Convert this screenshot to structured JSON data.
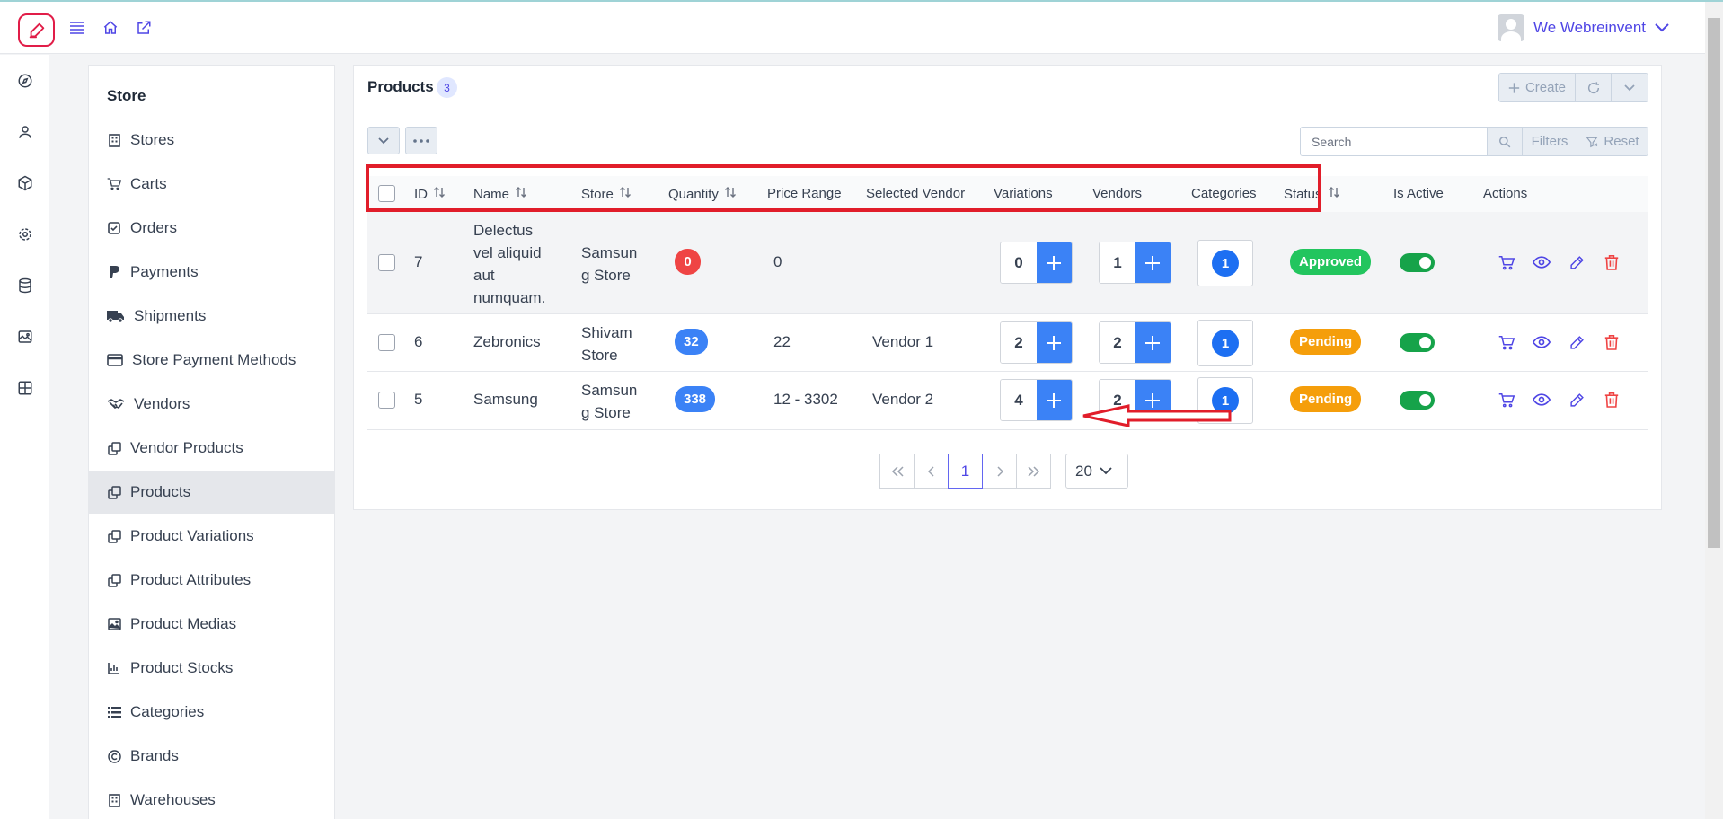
{
  "header": {
    "user_name": "We Webreinvent"
  },
  "icons": {
    "logo": "pencil-square-logo",
    "menu": "hamburger-icon",
    "home": "home-icon",
    "external": "external-link-icon"
  },
  "rail": [
    "compass-icon",
    "user-icon",
    "cube-icon",
    "gear-icon",
    "database-icon",
    "images-icon",
    "grid-icon"
  ],
  "store_menu": {
    "title": "Store",
    "items": [
      {
        "label": "Stores",
        "icon": "building-icon"
      },
      {
        "label": "Carts",
        "icon": "cart-icon"
      },
      {
        "label": "Orders",
        "icon": "check-square-icon"
      },
      {
        "label": "Payments",
        "icon": "paypal-icon"
      },
      {
        "label": "Shipments",
        "icon": "truck-icon"
      },
      {
        "label": "Store Payment Methods",
        "icon": "credit-card-icon"
      },
      {
        "label": "Vendors",
        "icon": "handshake-icon"
      },
      {
        "label": "Vendor Products",
        "icon": "copy-icon"
      },
      {
        "label": "Products",
        "icon": "copy-icon",
        "active": true
      },
      {
        "label": "Product Variations",
        "icon": "copy-icon"
      },
      {
        "label": "Product Attributes",
        "icon": "copy-icon"
      },
      {
        "label": "Product Medias",
        "icon": "image-icon"
      },
      {
        "label": "Product Stocks",
        "icon": "bar-chart-icon"
      },
      {
        "label": "Categories",
        "icon": "list-icon"
      },
      {
        "label": "Brands",
        "icon": "copyright-icon"
      },
      {
        "label": "Warehouses",
        "icon": "building-icon"
      }
    ]
  },
  "card": {
    "title": "Products",
    "count": "3",
    "create_label": "Create",
    "search_placeholder": "Search",
    "filters_label": "Filters",
    "reset_label": "Reset"
  },
  "table": {
    "columns": [
      "ID",
      "Name",
      "Store",
      "Quantity",
      "Price Range",
      "Selected Vendor",
      "Variations",
      "Vendors",
      "Categories",
      "Status",
      "Is Active",
      "Actions"
    ],
    "rows": [
      {
        "id": "7",
        "name": "Delectus vel aliquid aut numquam.",
        "store": "Samsung Store",
        "quantity": "0",
        "quantity_color": "#ef4444",
        "price_range": "0",
        "selected_vendor": "",
        "variations": "0",
        "vendors": "1",
        "categories": "1",
        "status": "Approved",
        "status_color": "#22c55e",
        "is_active": true
      },
      {
        "id": "6",
        "name": "Zebronics",
        "store": "Shivam Store",
        "quantity": "32",
        "quantity_color": "#3b82f6",
        "price_range": "22",
        "selected_vendor": "Vendor 1",
        "variations": "2",
        "vendors": "2",
        "categories": "1",
        "status": "Pending",
        "status_color": "#f59e0b",
        "is_active": true
      },
      {
        "id": "5",
        "name": "Samsung",
        "store": "Samsung Store",
        "quantity": "338",
        "quantity_color": "#3b82f6",
        "price_range": "12 - 3302",
        "selected_vendor": "Vendor 2",
        "variations": "4",
        "vendors": "2",
        "categories": "1",
        "status": "Pending",
        "status_color": "#f59e0b",
        "is_active": true
      }
    ]
  },
  "pagination": {
    "current_page": "1",
    "per_page": "20"
  },
  "colors": {
    "accent": "#4f46e5",
    "primary": "#3b82f6",
    "danger": "#ef4444",
    "success": "#22c55e",
    "warning": "#f59e0b",
    "annotation": "#e11d2a"
  }
}
